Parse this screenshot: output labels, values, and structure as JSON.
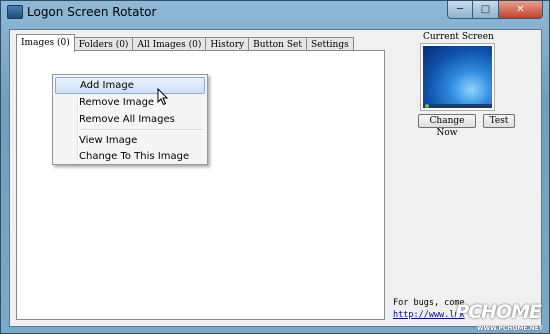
{
  "window": {
    "title": "Logon Screen Rotator"
  },
  "titlebar_buttons": {
    "minimize": "─",
    "maximize": "□",
    "close": "✕"
  },
  "tabs": [
    {
      "label": "Images (0)",
      "active": true
    },
    {
      "label": "Folders (0)",
      "active": false
    },
    {
      "label": "All Images (0)",
      "active": false
    },
    {
      "label": "History",
      "active": false
    },
    {
      "label": "Button Set",
      "active": false
    },
    {
      "label": "Settings",
      "active": false
    }
  ],
  "context_menu": {
    "items": [
      {
        "label": "Add Image",
        "highlighted": true
      },
      {
        "label": "Remove Image"
      },
      {
        "label": "Remove All Images"
      },
      {
        "label": "View Image"
      },
      {
        "label": "Change To This Image"
      }
    ]
  },
  "current_screen": {
    "label": "Current Screen",
    "change_now_label": "Change Now",
    "test_label": "Test"
  },
  "footer": {
    "bugs_text": "For bugs, come",
    "link_text": "http://www.luk"
  },
  "watermark": {
    "main": "PCHOME",
    "sub": "WWW.PCHOME.NET"
  },
  "colors": {
    "highlight": "#cce1f7",
    "link": "#0000cc",
    "close_button": "#c4422e"
  }
}
